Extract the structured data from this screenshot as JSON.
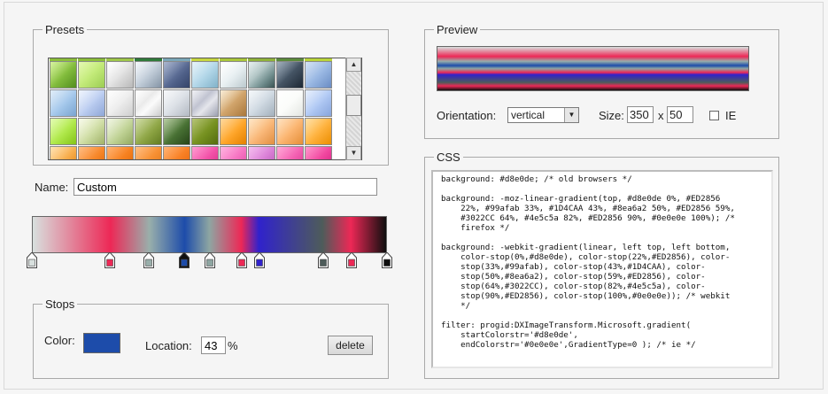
{
  "presets": {
    "legend": "Presets",
    "swatches": [
      {
        "g": "linear-gradient(135deg,#c1ec6c,#7bb832 55%,#5a9a20)"
      },
      {
        "g": "linear-gradient(135deg,#d6f58a,#a9de5a)"
      },
      {
        "g": "linear-gradient(135deg,#ffffff,#dcdcdc 60%,#c8c8c8)"
      },
      {
        "g": "linear-gradient(135deg,#eef3f8,#b6c3d1 60%,#8fa0b3)"
      },
      {
        "g": "linear-gradient(135deg,#7d8fb5,#4a5c87 60%,#3a4a72)"
      },
      {
        "g": "linear-gradient(135deg,#d9ecf5,#a9d2e6 60%,#8cc1da)"
      },
      {
        "g": "linear-gradient(135deg,#ffffff,#e3ecef 60%,#cbdadf)"
      },
      {
        "g": "linear-gradient(135deg,#d8e6e6,#a9bfbf 40%,#6f8e8e 70%,#3f5a5a)"
      },
      {
        "g": "linear-gradient(135deg,#6f8599,#3b4b5c 50%,#1f2b38)"
      },
      {
        "g": "linear-gradient(135deg,#bcd2ef,#8fb0e0 60%,#7398d4)"
      },
      {
        "g": "linear-gradient(135deg,#cfe2f5,#9cc3ea 60%,#84b2e2)"
      },
      {
        "g": "linear-gradient(135deg,#e6eefc,#b3c7ef 60%,#9bb5ea)"
      },
      {
        "g": "linear-gradient(135deg,#fdfdfd,#eaeaea 60%,#e0e0e0)"
      },
      {
        "g": "linear-gradient(135deg,#ffffff,#e8e8e8 40%,#ffffff 60%,#dcdcdc)"
      },
      {
        "g": "linear-gradient(135deg,#f2f4f7,#d6dbe2 60%,#c2c9d3)"
      },
      {
        "g": "linear-gradient(135deg,#e8e9ef,#b9bccb 40%,#e8e9ef 60%,#a9adbf)"
      },
      {
        "g": "linear-gradient(135deg,#f5e2bf,#cfa064 50%,#b88240)"
      },
      {
        "g": "linear-gradient(135deg,#f0f4f8,#c8d3dd 60%,#b0bfcc)"
      },
      {
        "g": "linear-gradient(135deg,#ffffff,#f7faf5)"
      },
      {
        "g": "linear-gradient(135deg,#d9e6fb,#a8c3f3 60%,#93b3ef)"
      },
      {
        "g": "linear-gradient(135deg,#d4fa8a,#a9e63c 60%,#8fd51a)"
      },
      {
        "g": "linear-gradient(135deg,#f4f8df,#c9d99a 60%,#aec070)"
      },
      {
        "g": "linear-gradient(135deg,#e9f0d6,#bcd08e 60%,#9fb768)"
      },
      {
        "g": "linear-gradient(135deg,#b7c978,#87a03a 60%,#6b8624)"
      },
      {
        "g": "linear-gradient(135deg,#8fb070,#3f6a2a 55%,#2a4a1a)"
      },
      {
        "g": "linear-gradient(135deg,#8ea42e,#6d8a14 60%,#5b7610)"
      },
      {
        "g": "linear-gradient(135deg,#ffc46a,#ff9f1a 60%,#f68b00)"
      },
      {
        "g": "linear-gradient(135deg,#ffd9a9,#f9b06b 60%,#f39a46)"
      },
      {
        "g": "linear-gradient(135deg,#ffd2a0,#fbae63 60%,#f89a3c)"
      },
      {
        "g": "linear-gradient(135deg,#ffcf78,#ffab2c 60%,#ff9a00)"
      },
      {
        "g": "linear-gradient(135deg,#ffd38a,#f7a43a 60%,#f08c12)"
      },
      {
        "g": "linear-gradient(135deg,#ff9a42,#f06b00)"
      },
      {
        "g": "linear-gradient(135deg,#ff8c2a,#ee6a00)"
      },
      {
        "g": "linear-gradient(135deg,#ff9c42,#f07a12)"
      },
      {
        "g": "linear-gradient(135deg,#ff8a2a,#f26a0a)"
      },
      {
        "g": "linear-gradient(135deg,#ff66b8,#e52c8f)"
      },
      {
        "g": "linear-gradient(135deg,#ff8ccf,#ee4fb0)"
      },
      {
        "g": "linear-gradient(135deg,#f09be8,#c25ac2)"
      },
      {
        "g": "linear-gradient(135deg,#ff7ac2,#e8399b)"
      },
      {
        "g": "linear-gradient(135deg,#ff5fb0,#e21d86)"
      }
    ],
    "top_strip": [
      "#8bbd3a",
      "#8bbd3a",
      "#9ec64a",
      "#2f7a3a",
      "#7aa7b8",
      "#c6d640",
      "#a9c63a",
      "#8fb23a",
      "#5b8a3a",
      "#b9d43a"
    ]
  },
  "scroll": {
    "up": "▲",
    "down": "▼"
  },
  "name": {
    "label": "Name:",
    "value": "Custom"
  },
  "gradient": {
    "css": "linear-gradient(to right,#d8e0de 0%,#ED2856 22%,#99afab 33%,#1D4CAA 43%,#8ea6a2 50%,#ED2856 59%,#3022CC 64%,#4e5c5a 82%,#ED2856 90%,#0e0e0e 100%)",
    "stops": [
      {
        "pos": 0,
        "color": "#d8e0de",
        "selected": false
      },
      {
        "pos": 22,
        "color": "#ED2856",
        "selected": false
      },
      {
        "pos": 33,
        "color": "#99afab",
        "selected": false
      },
      {
        "pos": 43,
        "color": "#1D4CAA",
        "selected": true
      },
      {
        "pos": 50,
        "color": "#8ea6a2",
        "selected": false
      },
      {
        "pos": 59,
        "color": "#ED2856",
        "selected": false
      },
      {
        "pos": 64,
        "color": "#3022CC",
        "selected": false
      },
      {
        "pos": 82,
        "color": "#4e5c5a",
        "selected": false
      },
      {
        "pos": 90,
        "color": "#ED2856",
        "selected": false
      },
      {
        "pos": 100,
        "color": "#0e0e0e",
        "selected": false
      }
    ]
  },
  "stops_panel": {
    "legend": "Stops",
    "color_label": "Color:",
    "color_value": "#1D4CAA",
    "location_label": "Location:",
    "location_value": "43",
    "percent": "%",
    "delete_label": "delete"
  },
  "preview": {
    "legend": "Preview",
    "css": "linear-gradient(to bottom,#d8e0de 0%,#ED2856 22%,#99afab 33%,#1D4CAA 43%,#8ea6a2 50%,#ED2856 59%,#3022CC 64%,#4e5c5a 82%,#ED2856 90%,#0e0e0e 100%)",
    "orientation_label": "Orientation:",
    "orientation_value": "vertical",
    "size_label": "Size:",
    "width": "350",
    "x": "x",
    "height": "50",
    "ie_label": "IE"
  },
  "css": {
    "legend": "CSS",
    "blocks": [
      "background: #d8e0de; /* old browsers */",
      "background: -moz-linear-gradient(top, #d8e0de 0%, #ED2856\n    22%, #99afab 33%, #1D4CAA 43%, #8ea6a2 50%, #ED2856 59%,\n    #3022CC 64%, #4e5c5a 82%, #ED2856 90%, #0e0e0e 100%); /*\n    firefox */",
      "background: -webkit-gradient(linear, left top, left bottom,\n    color-stop(0%,#d8e0de), color-stop(22%,#ED2856), color-\n    stop(33%,#99afab), color-stop(43%,#1D4CAA), color-\n    stop(50%,#8ea6a2), color-stop(59%,#ED2856), color-\n    stop(64%,#3022CC), color-stop(82%,#4e5c5a), color-\n    stop(90%,#ED2856), color-stop(100%,#0e0e0e)); /* webkit\n    */",
      "filter: progid:DXImageTransform.Microsoft.gradient(\n    startColorstr='#d8e0de',\n    endColorstr='#0e0e0e',GradientType=0 ); /* ie */"
    ]
  }
}
